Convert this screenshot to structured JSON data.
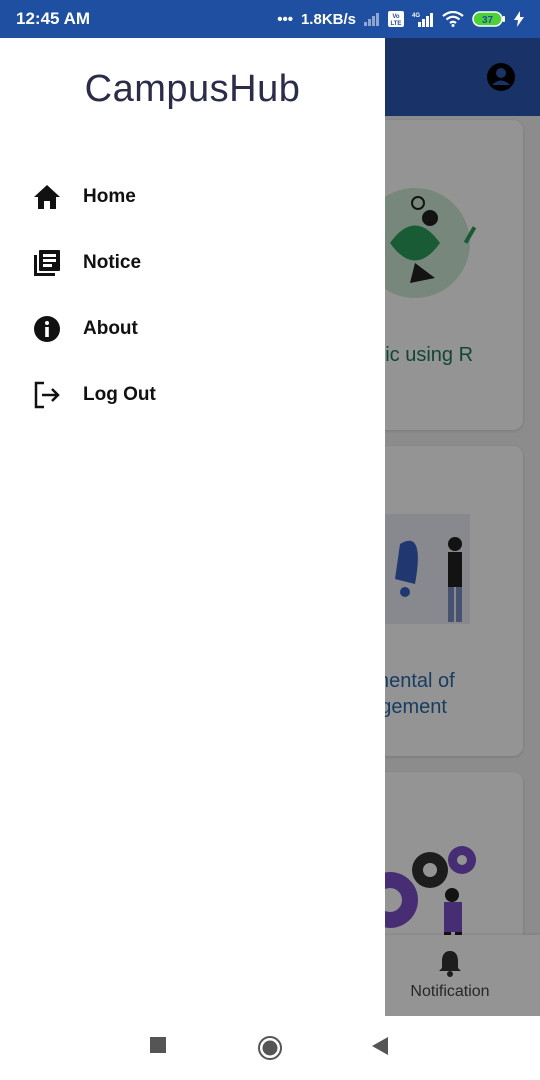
{
  "status_bar": {
    "time": "12:45 AM",
    "network_speed": "1.8KB/s",
    "battery": "37",
    "icons": [
      "signal-icon",
      "volte-icon",
      "4g-signal-icon",
      "wifi-icon",
      "battery-icon",
      "charging-icon"
    ]
  },
  "drawer": {
    "title": "CampusHub",
    "items": [
      {
        "label": "Home",
        "icon": "home-icon"
      },
      {
        "label": "Notice",
        "icon": "notice-icon"
      },
      {
        "label": "About",
        "icon": "info-icon"
      },
      {
        "label": "Log Out",
        "icon": "logout-icon"
      }
    ]
  },
  "background": {
    "cards": [
      {
        "title": "nalytic using R"
      },
      {
        "title": "amental of agement"
      },
      {
        "title": ""
      }
    ],
    "bottom_nav": {
      "notification_label": "Notification"
    }
  },
  "colors": {
    "status_bar": "#1e4fa0",
    "app_header": "#2c59b3",
    "drawer_title": "#2b2b4a",
    "scrim": "rgba(0,0,0,0.42)"
  }
}
